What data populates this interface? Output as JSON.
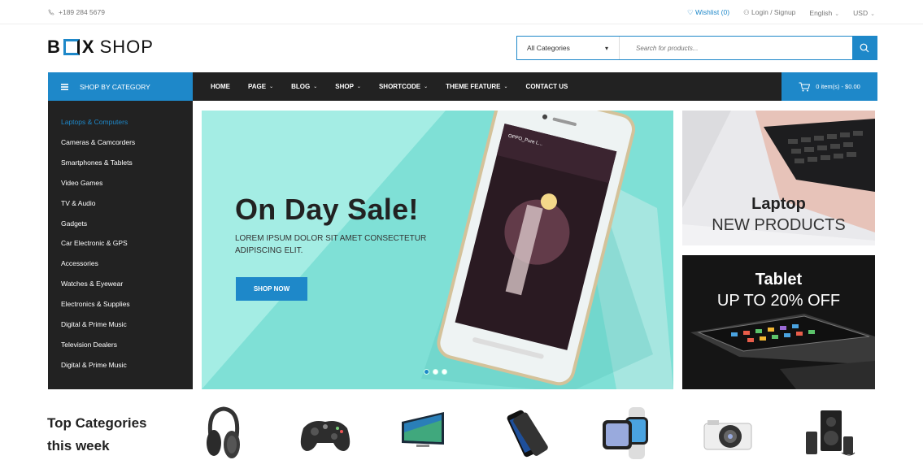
{
  "topbar": {
    "phone": "+189 284 5679",
    "wishlist": "Wishlist (0)",
    "account": "Login / Signup",
    "language": "English",
    "currency": "USD"
  },
  "logo": {
    "part1": "B",
    "part2": "X",
    "part3": "SHOP"
  },
  "search": {
    "category": "All Categories",
    "placeholder": "Search for products..."
  },
  "nav": {
    "category_button": "SHOP BY CATEGORY",
    "items": [
      {
        "label": "HOME",
        "dropdown": false
      },
      {
        "label": "PAGE",
        "dropdown": true
      },
      {
        "label": "BLOG",
        "dropdown": true
      },
      {
        "label": "SHOP",
        "dropdown": true
      },
      {
        "label": "SHORTCODE",
        "dropdown": true
      },
      {
        "label": "THEME FEATURE",
        "dropdown": true
      },
      {
        "label": "CONTACT US",
        "dropdown": false
      }
    ],
    "cart": "0 item(s) - $0.00"
  },
  "sidebar": {
    "items": [
      "Laptops & Computers",
      "Cameras & Camcorders",
      "Smartphones & Tablets",
      "Video Games",
      "TV & Audio",
      "Gadgets",
      "Car Electronic & GPS",
      "Accessories",
      "Watches & Eyewear",
      "Electronics & Supplies",
      "Digital & Prime Music",
      "Television Dealers",
      "Digital & Prime Music"
    ]
  },
  "hero": {
    "title": "On Day Sale!",
    "subtitle": "Lorem ipsum dolor sit amet consectetur adipiscing elit.",
    "button": "SHOP NOW",
    "phone_label": "OPPO_Pure L..."
  },
  "banners": [
    {
      "title": "Laptop",
      "subtitle": "NEW PRODUCTS"
    },
    {
      "title": "Tablet",
      "subtitle": "UP TO 20% OFF"
    }
  ],
  "top_categories": {
    "heading_line1": "Top Categories",
    "heading_line2": "this week",
    "items": [
      "headphones-image",
      "gamepad-image",
      "tv-image",
      "smartphone-image",
      "smartwatch-image",
      "camera-image",
      "speakers-image"
    ]
  },
  "colors": {
    "accent": "#1e88c9",
    "dark": "#222222",
    "hero_bg": "#7fe0d6"
  }
}
